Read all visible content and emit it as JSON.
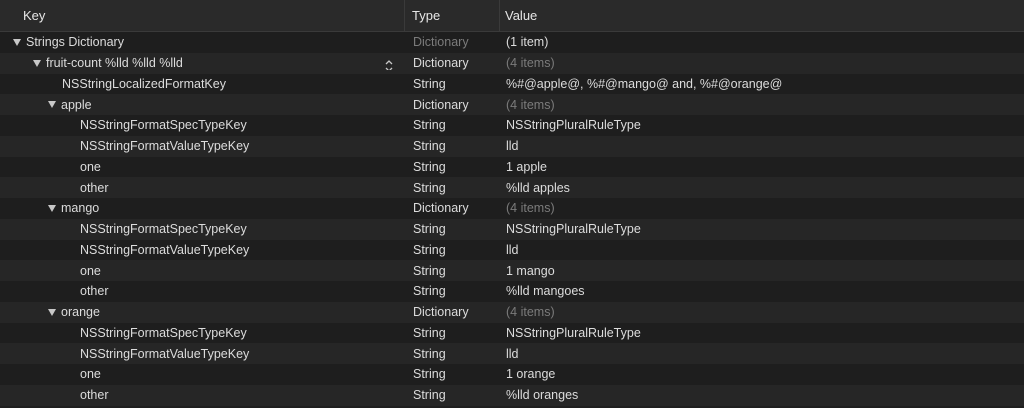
{
  "columns": {
    "key": "Key",
    "type": "Type",
    "value": "Value"
  },
  "rows": [
    {
      "key": "Strings Dictionary",
      "type": "Dictionary",
      "value": "(1 item)"
    },
    {
      "key": "fruit-count %lld %lld %lld",
      "type": "Dictionary",
      "value": "(4 items)"
    },
    {
      "key": "NSStringLocalizedFormatKey",
      "type": "String",
      "value": "%#@apple@, %#@mango@ and, %#@orange@"
    },
    {
      "key": "apple",
      "type": "Dictionary",
      "value": "(4 items)"
    },
    {
      "key": "NSStringFormatSpecTypeKey",
      "type": "String",
      "value": "NSStringPluralRuleType"
    },
    {
      "key": "NSStringFormatValueTypeKey",
      "type": "String",
      "value": "lld"
    },
    {
      "key": "one",
      "type": "String",
      "value": "1 apple"
    },
    {
      "key": "other",
      "type": "String",
      "value": "%lld apples"
    },
    {
      "key": "mango",
      "type": "Dictionary",
      "value": "(4 items)"
    },
    {
      "key": "NSStringFormatSpecTypeKey",
      "type": "String",
      "value": "NSStringPluralRuleType"
    },
    {
      "key": "NSStringFormatValueTypeKey",
      "type": "String",
      "value": "lld"
    },
    {
      "key": "one",
      "type": "String",
      "value": "1 mango"
    },
    {
      "key": "other",
      "type": "String",
      "value": "%lld mangoes"
    },
    {
      "key": "orange",
      "type": "Dictionary",
      "value": "(4 items)"
    },
    {
      "key": "NSStringFormatSpecTypeKey",
      "type": "String",
      "value": "NSStringPluralRuleType"
    },
    {
      "key": "NSStringFormatValueTypeKey",
      "type": "String",
      "value": "lld"
    },
    {
      "key": "one",
      "type": "String",
      "value": "1 orange"
    },
    {
      "key": "other",
      "type": "String",
      "value": "%lld oranges"
    }
  ],
  "icons": {
    "disclosure": "disclosure-triangle-icon",
    "stepper": "up-down-stepper-icon"
  },
  "colors": {
    "background": "#1f1f1f",
    "header": "#2a2a2a",
    "text": "#dcdcdc",
    "dimText": "#7b7b7b"
  }
}
